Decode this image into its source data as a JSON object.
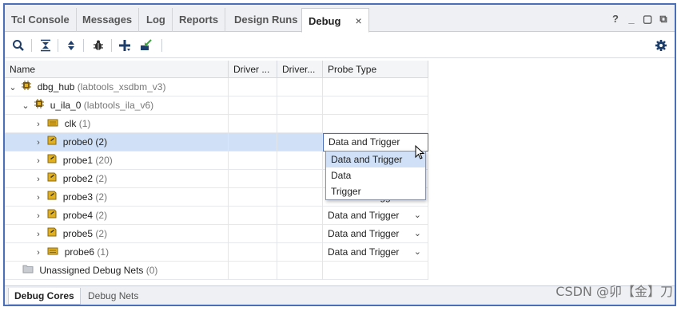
{
  "tabs": [
    {
      "label": "Tcl Console"
    },
    {
      "label": "Messages"
    },
    {
      "label": "Log"
    },
    {
      "label": "Reports"
    },
    {
      "label": "Design Runs"
    },
    {
      "label": "Debug",
      "close": "×"
    }
  ],
  "window_controls": {
    "help": "?",
    "minimize": "_",
    "restore": "▢",
    "float": "⧉"
  },
  "toolbar_icons": [
    "search-icon",
    "collapse-all-icon",
    "expand-all-icon",
    "debug-bug-icon",
    "add-icon",
    "import-icon",
    "settings-icon"
  ],
  "table": {
    "headers": {
      "name": "Name",
      "driver1": "Driver ...",
      "driver2": "Driver...",
      "probe_type": "Probe Type"
    },
    "rows": [
      {
        "label": "dbg_hub",
        "detail": "(labtools_xsdbm_v3)",
        "probe_type": ""
      },
      {
        "label": "u_ila_0",
        "detail": "(labtools_ila_v6)",
        "probe_type": ""
      },
      {
        "label": "clk",
        "detail": "(1)",
        "probe_type": ""
      },
      {
        "label": "probe0",
        "detail": "(2)",
        "probe_type": "Data and Trigger"
      },
      {
        "label": "probe1",
        "detail": "(20)",
        "probe_type": ""
      },
      {
        "label": "probe2",
        "detail": "(2)",
        "probe_type": ""
      },
      {
        "label": "probe3",
        "detail": "(2)",
        "probe_type": "Data and Trigger"
      },
      {
        "label": "probe4",
        "detail": "(2)",
        "probe_type": "Data and Trigger"
      },
      {
        "label": "probe5",
        "detail": "(2)",
        "probe_type": "Data and Trigger"
      },
      {
        "label": "probe6",
        "detail": "(1)",
        "probe_type": "Data and Trigger"
      },
      {
        "label": "Unassigned Debug Nets",
        "detail": "(0)",
        "probe_type": ""
      }
    ]
  },
  "dropdown": {
    "options": [
      "Data and Trigger",
      "Data",
      "Trigger"
    ],
    "selected": "Data and Trigger"
  },
  "bottom_tabs": [
    {
      "label": "Debug Cores"
    },
    {
      "label": "Debug Nets"
    }
  ],
  "watermark": "CSDN @卯【金】刀",
  "colors": {
    "accent": "#4a6fb8",
    "selection": "#cfe0f7",
    "chip_icon": "#7a5a10",
    "probe_icon": "#e0b020"
  }
}
